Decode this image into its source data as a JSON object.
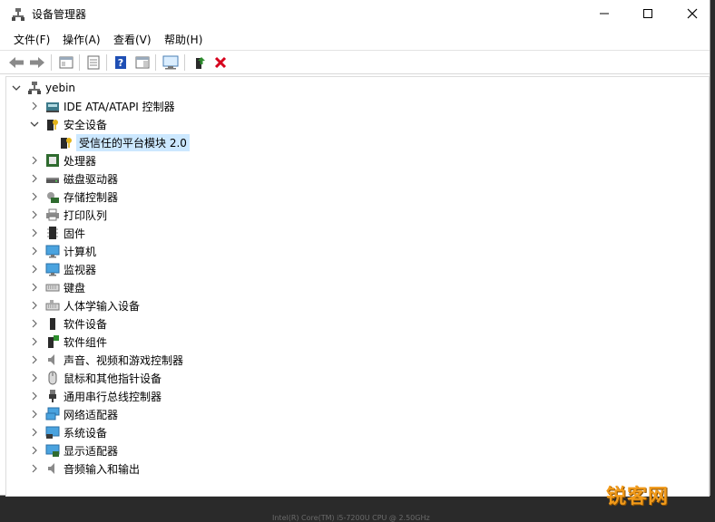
{
  "window": {
    "title": "设备管理器",
    "controls": {
      "minimize": "minimize",
      "maximize": "maximize",
      "close": "close"
    }
  },
  "menu": [
    "文件(F)",
    "操作(A)",
    "查看(V)",
    "帮助(H)"
  ],
  "toolbar": {
    "buttons": [
      "back-icon",
      "forward-icon",
      "show-hide-console-tree-icon",
      "properties-icon",
      "help-icon",
      "action-pane-icon",
      "scan-hardware-icon",
      "update-driver-icon",
      "uninstall-device-icon"
    ],
    "colors": {
      "uninstall": "#d6001c",
      "update": "#2e8b2e",
      "help": "#1f4fb4"
    }
  },
  "tree": {
    "root": "yebin",
    "items": [
      {
        "label": "IDE ATA/ATAPI 控制器",
        "icon": "ide-controller-icon"
      },
      {
        "label": "安全设备",
        "icon": "security-device-icon",
        "expanded": true,
        "children": [
          {
            "label": "受信任的平台模块 2.0",
            "icon": "tpm-icon",
            "selected": true
          }
        ]
      },
      {
        "label": "处理器",
        "icon": "processor-icon"
      },
      {
        "label": "磁盘驱动器",
        "icon": "disk-drive-icon"
      },
      {
        "label": "存储控制器",
        "icon": "storage-controller-icon"
      },
      {
        "label": "打印队列",
        "icon": "print-queue-icon"
      },
      {
        "label": "固件",
        "icon": "firmware-icon"
      },
      {
        "label": "计算机",
        "icon": "computer-icon"
      },
      {
        "label": "监视器",
        "icon": "monitor-icon"
      },
      {
        "label": "键盘",
        "icon": "keyboard-icon"
      },
      {
        "label": "人体学输入设备",
        "icon": "hid-icon"
      },
      {
        "label": "软件设备",
        "icon": "software-device-icon"
      },
      {
        "label": "软件组件",
        "icon": "software-component-icon"
      },
      {
        "label": "声音、视频和游戏控制器",
        "icon": "audio-icon"
      },
      {
        "label": "鼠标和其他指针设备",
        "icon": "mouse-icon"
      },
      {
        "label": "通用串行总线控制器",
        "icon": "usb-icon"
      },
      {
        "label": "网络适配器",
        "icon": "network-adapter-icon"
      },
      {
        "label": "系统设备",
        "icon": "system-device-icon"
      },
      {
        "label": "显示适配器",
        "icon": "display-adapter-icon"
      },
      {
        "label": "音频输入和输出",
        "icon": "audio-io-icon"
      }
    ]
  },
  "watermark": "锐客网",
  "background_text": "Intel(R) Core(TM) i5-7200U CPU @ 2.50GHz"
}
